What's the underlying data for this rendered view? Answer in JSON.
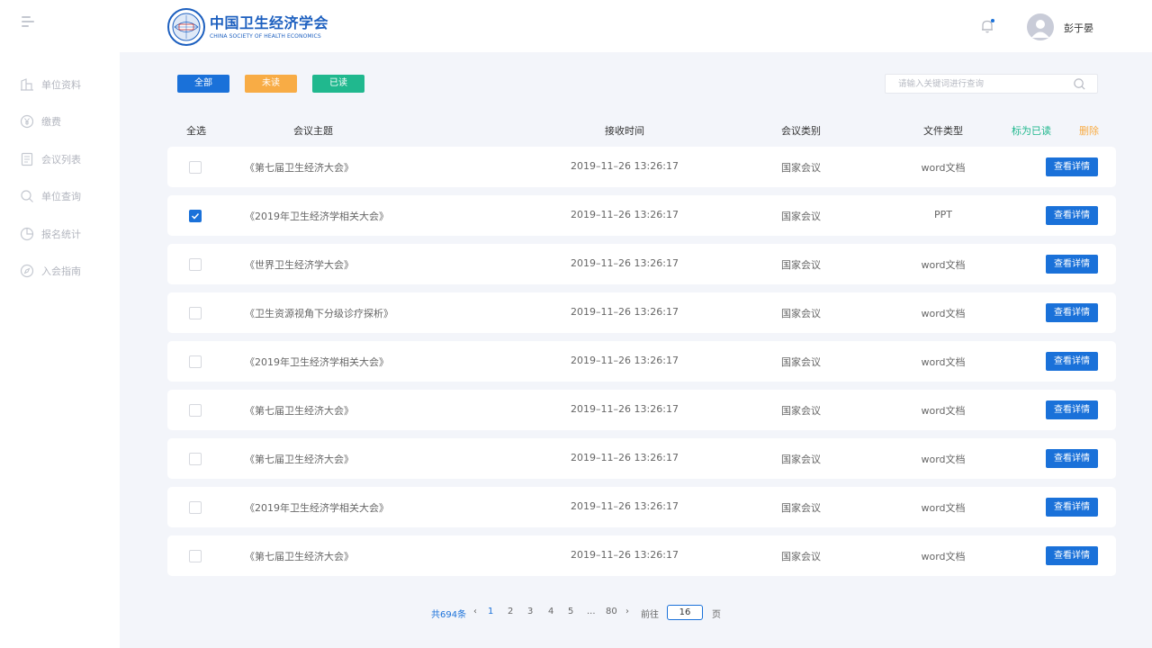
{
  "header": {
    "brand_name": "中国卫生经济学会",
    "brand_sub": "CHINA SOCIETY OF HEALTH ECONOMICS",
    "username": "彭于晏"
  },
  "sidebar": {
    "items": [
      {
        "label": "单位资料",
        "icon": "building-icon"
      },
      {
        "label": "缴费",
        "icon": "yen-icon"
      },
      {
        "label": "会议列表",
        "icon": "document-icon"
      },
      {
        "label": "单位查询",
        "icon": "search-icon"
      },
      {
        "label": "报名统计",
        "icon": "pie-chart-icon"
      },
      {
        "label": "入会指南",
        "icon": "compass-icon"
      }
    ]
  },
  "filters": {
    "all": "全部",
    "unread": "未读",
    "read": "已读"
  },
  "search": {
    "placeholder": "请输入关键词进行查询"
  },
  "table": {
    "headers": {
      "select_all": "全选",
      "topic": "会议主题",
      "time": "接收时间",
      "category": "会议类别",
      "file_type": "文件类型",
      "mark_read": "标为已读",
      "delete": "删除"
    },
    "detail_label": "查看详情",
    "rows": [
      {
        "checked": false,
        "topic": "《第七届卫生经济大会》",
        "time": "2019–11–26  13:26:17",
        "category": "国家会议",
        "file_type": "word文档"
      },
      {
        "checked": true,
        "topic": "《2019年卫生经济学相关大会》",
        "time": "2019–11–26  13:26:17",
        "category": "国家会议",
        "file_type": "PPT"
      },
      {
        "checked": false,
        "topic": "《世界卫生经济学大会》",
        "time": "2019–11–26  13:26:17",
        "category": "国家会议",
        "file_type": "word文档"
      },
      {
        "checked": false,
        "topic": "《卫生资源视角下分级诊疗探析》",
        "time": "2019–11–26  13:26:17",
        "category": "国家会议",
        "file_type": "word文档"
      },
      {
        "checked": false,
        "topic": "《2019年卫生经济学相关大会》",
        "time": "2019–11–26  13:26:17",
        "category": "国家会议",
        "file_type": "word文档"
      },
      {
        "checked": false,
        "topic": "《第七届卫生经济大会》",
        "time": "2019–11–26  13:26:17",
        "category": "国家会议",
        "file_type": "word文档"
      },
      {
        "checked": false,
        "topic": "《第七届卫生经济大会》",
        "time": "2019–11–26  13:26:17",
        "category": "国家会议",
        "file_type": "word文档"
      },
      {
        "checked": false,
        "topic": "《2019年卫生经济学相关大会》",
        "time": "2019–11–26  13:26:17",
        "category": "国家会议",
        "file_type": "word文档"
      },
      {
        "checked": false,
        "topic": "《第七届卫生经济大会》",
        "time": "2019–11–26  13:26:17",
        "category": "国家会议",
        "file_type": "word文档"
      }
    ]
  },
  "pagination": {
    "total": "共694条",
    "prev": "‹",
    "pages": [
      "1",
      "2",
      "3",
      "4",
      "5",
      "...",
      "80"
    ],
    "current": "1",
    "next": "›",
    "goto_label": "前往",
    "goto_value": "16",
    "page_suffix": "页"
  },
  "colors": {
    "primary": "#1a71d9",
    "unread": "#f8ac45",
    "read": "#20b88e",
    "background": "#f3f5fa"
  }
}
